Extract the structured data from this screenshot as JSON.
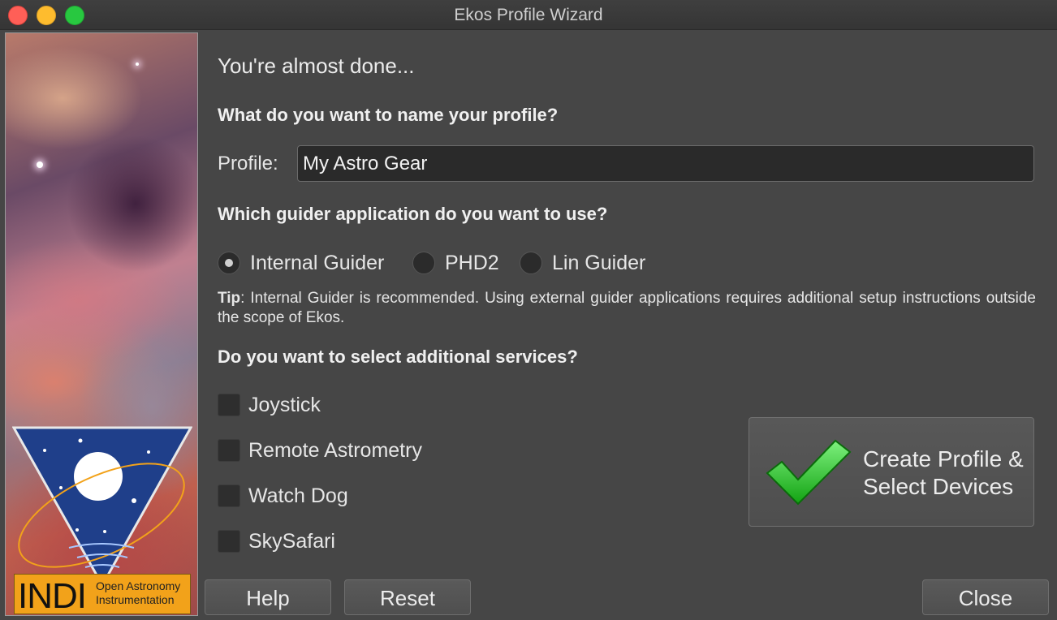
{
  "window": {
    "title": "Ekos Profile Wizard"
  },
  "sidebar": {
    "logo_text": "INDI",
    "logo_subtext_1": "Open Astronomy",
    "logo_subtext_2": "Instrumentation"
  },
  "page": {
    "heading": "You're almost done...",
    "name_question": "What do you want to name your profile?",
    "profile_label": "Profile:",
    "profile_value": "My Astro Gear",
    "guider_question": "Which guider application do you want to use?",
    "guiders": [
      {
        "label": "Internal Guider",
        "checked": true
      },
      {
        "label": "PHD2",
        "checked": false
      },
      {
        "label": "Lin Guider",
        "checked": false
      }
    ],
    "tip_label": "Tip",
    "tip_text": ": Internal Guider is recommended. Using external guider applications requires additional setup instructions outside the scope of Ekos.",
    "services_question": "Do you want to select additional services?",
    "services": [
      {
        "label": "Joystick",
        "checked": false
      },
      {
        "label": "Remote Astrometry",
        "checked": false
      },
      {
        "label": "Watch Dog",
        "checked": false
      },
      {
        "label": "SkySafari",
        "checked": false
      }
    ],
    "create_button_line1": "Create Profile &",
    "create_button_line2": "Select Devices"
  },
  "buttons": {
    "help": "Help",
    "reset": "Reset",
    "close": "Close"
  },
  "colors": {
    "window_bg": "#464646",
    "checkmark": "#2fc22f",
    "logo_bg": "#f2a21a"
  },
  "icons": {
    "create": "green-checkmark-icon"
  }
}
